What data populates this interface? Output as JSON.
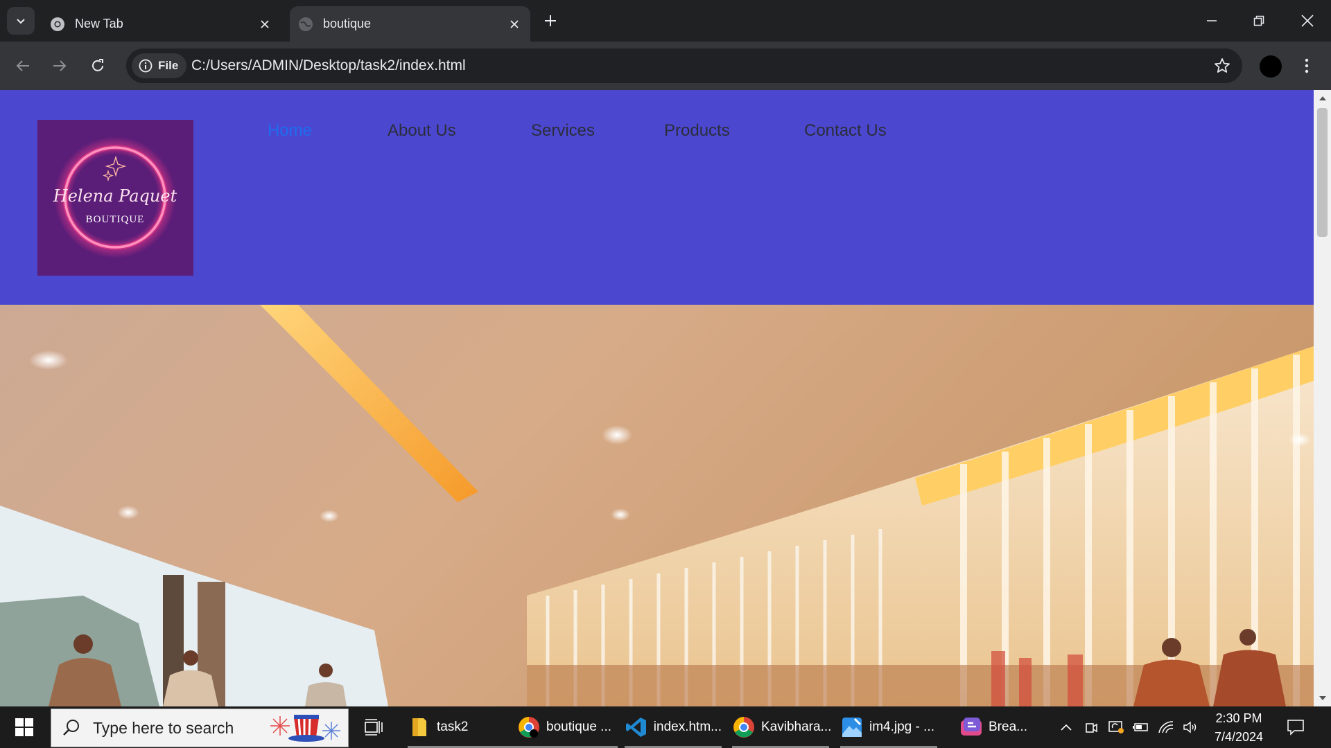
{
  "browser": {
    "tabs": [
      {
        "title": "New Tab",
        "active": false
      },
      {
        "title": "boutique",
        "active": true
      }
    ],
    "address": {
      "chip_label": "File",
      "url": "C:/Users/ADMIN/Desktop/task2/index.html"
    }
  },
  "site": {
    "logo": {
      "script_name": "Helena Paquet",
      "tagline": "BOUTIQUE"
    },
    "nav": [
      {
        "label": "Home",
        "active": true
      },
      {
        "label": "About Us",
        "active": false
      },
      {
        "label": "Services",
        "active": false
      },
      {
        "label": "Products",
        "active": false
      },
      {
        "label": "Contact Us",
        "active": false
      }
    ],
    "colors": {
      "header_bg": "#4b48cf",
      "nav_active": "#1e6cf0",
      "nav_text": "#2b2d3a",
      "logo_bg": "#5a1d78",
      "logo_ring": "#ff3c8c"
    }
  },
  "taskbar": {
    "search_placeholder": "Type here to search",
    "apps": [
      {
        "label": "task2",
        "icon": "folder-icon"
      },
      {
        "label": "boutique ...",
        "icon": "chrome-icon"
      },
      {
        "label": "index.htm...",
        "icon": "vscode-icon"
      },
      {
        "label": "Kavibhara...",
        "icon": "chrome-icon"
      },
      {
        "label": "im4.jpg - ...",
        "icon": "photos-icon"
      },
      {
        "label": "Brea...",
        "icon": "clipchamp-icon"
      }
    ],
    "clock": {
      "time": "2:30 PM",
      "date": "7/4/2024"
    }
  }
}
